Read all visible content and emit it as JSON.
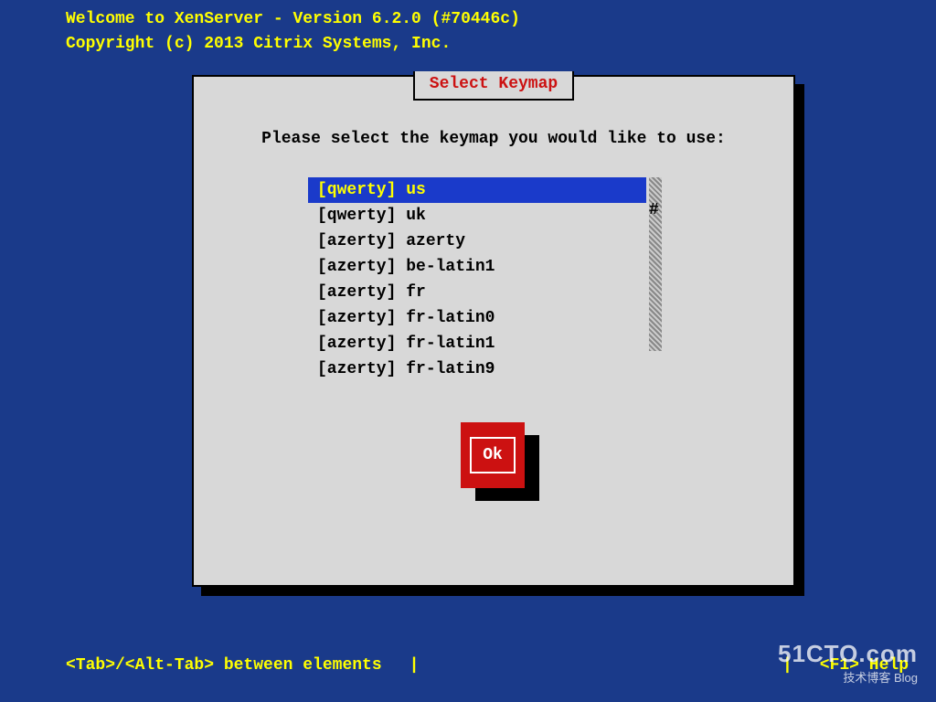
{
  "header": {
    "line1": "Welcome to XenServer - Version 6.2.0 (#70446c)",
    "line2": "Copyright (c) 2013 Citrix Systems, Inc."
  },
  "dialog": {
    "title": "Select Keymap",
    "prompt": "Please select the keymap you would like to use:",
    "items": [
      "[qwerty] us",
      "[qwerty] uk",
      "[azerty] azerty",
      "[azerty] be-latin1",
      "[azerty] fr",
      "[azerty] fr-latin0",
      "[azerty] fr-latin1",
      "[azerty] fr-latin9"
    ],
    "selected_index": 0,
    "ok_label": "Ok",
    "scroll_marker": "#"
  },
  "footer": {
    "left": "<Tab>/<Alt-Tab> between elements",
    "sep": "|",
    "right": "<F1> Help"
  },
  "watermark": {
    "main": "51CTO.com",
    "sub": "技术博客  Blog"
  }
}
